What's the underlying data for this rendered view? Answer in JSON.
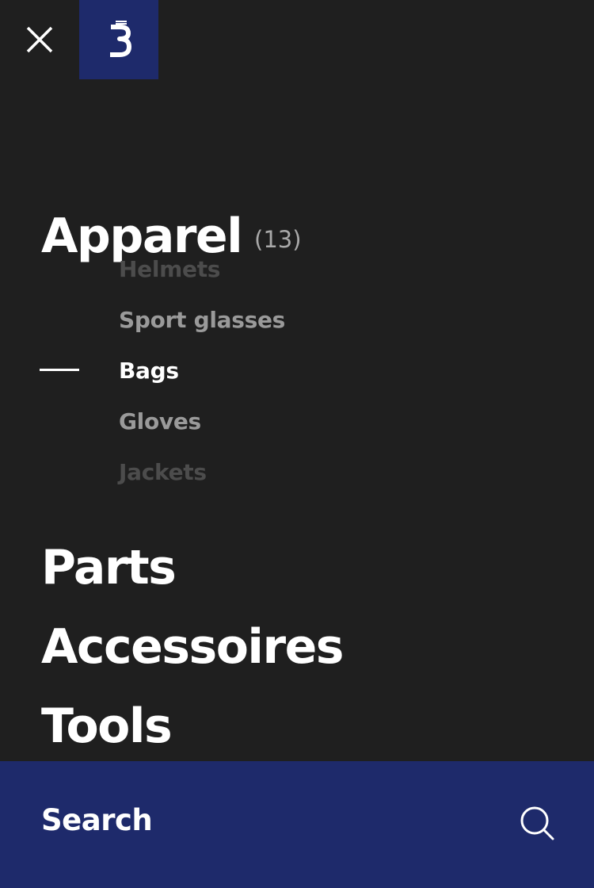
{
  "header": {
    "close_icon": "close-icon",
    "logo_icon": "brand-b-logo",
    "logo_background": "#1e2a6b"
  },
  "menu": {
    "apparel": {
      "label": "Apparel",
      "count": "(13)",
      "subitems": [
        {
          "label": "Helmets",
          "state": "faded"
        },
        {
          "label": "Sport glasses",
          "state": "dim"
        },
        {
          "label": "Bags",
          "state": "active"
        },
        {
          "label": "Gloves",
          "state": "dim"
        },
        {
          "label": "Jackets",
          "state": "faded"
        }
      ]
    },
    "parts": {
      "label": "Parts"
    },
    "accessoires": {
      "label": "Accessoires"
    },
    "tools": {
      "label": "Tools"
    }
  },
  "search": {
    "label": "Search",
    "icon": "search-icon"
  },
  "colors": {
    "background": "#1f1f1f",
    "accent": "#1e2a6b",
    "text_primary": "#ffffff",
    "text_dim": "#9a9a9a",
    "text_faded": "#4c4c4c"
  }
}
